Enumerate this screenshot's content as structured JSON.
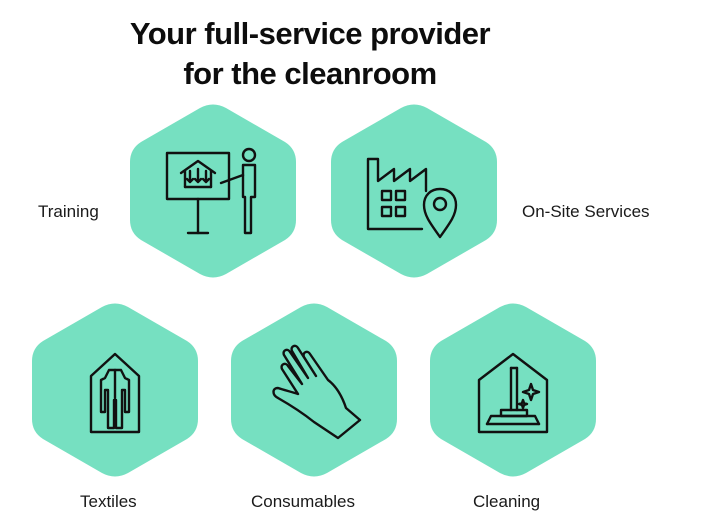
{
  "heading": {
    "line1": "Your full-service provider",
    "line2": "for the cleanroom"
  },
  "hex_color": "#76e0c1",
  "icon_color": "#111111",
  "services": [
    {
      "label": "Training",
      "icon": "training-presentation-icon"
    },
    {
      "label": "On-Site Services",
      "icon": "factory-location-icon"
    },
    {
      "label": "Textiles",
      "icon": "cleanroom-suit-icon"
    },
    {
      "label": "Consumables",
      "icon": "glove-icon"
    },
    {
      "label": "Cleaning",
      "icon": "cleaning-mop-icon"
    }
  ]
}
